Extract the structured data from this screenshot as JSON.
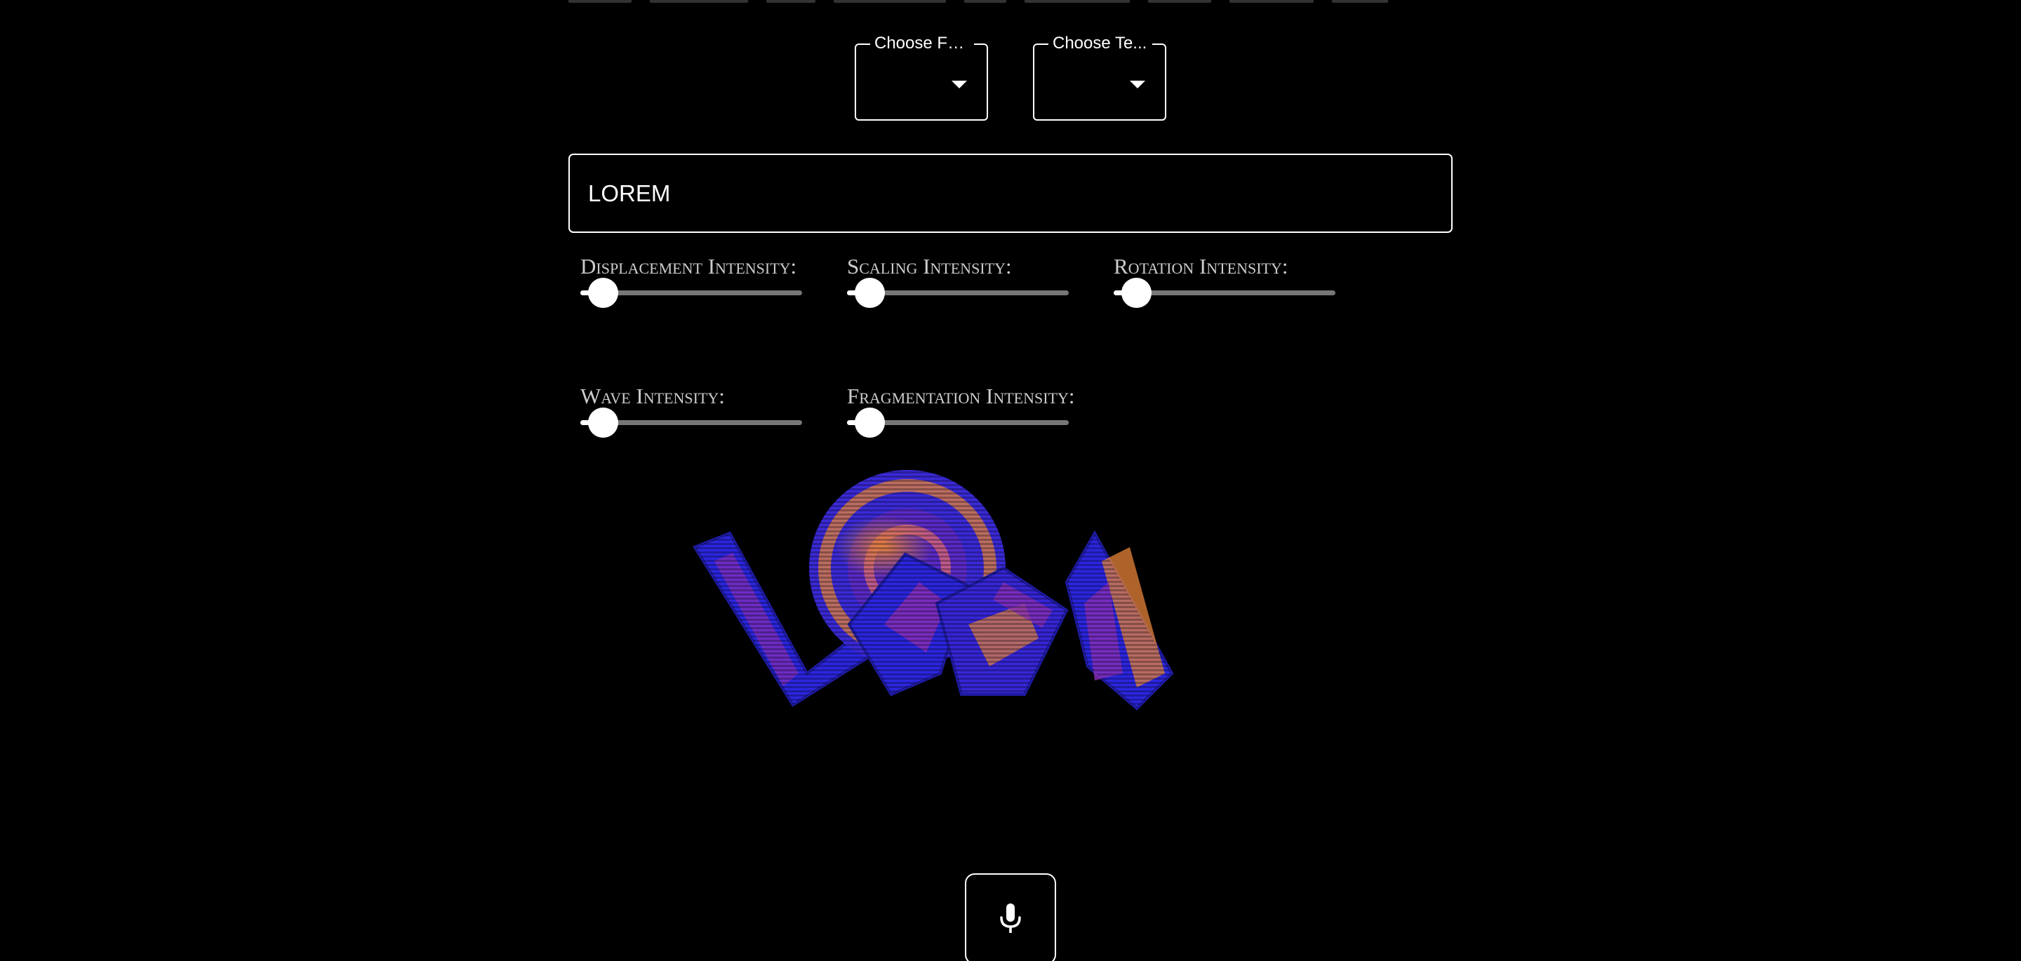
{
  "selects": [
    {
      "label": "Choose Font",
      "value": ""
    },
    {
      "label": "Choose Te...",
      "value": ""
    }
  ],
  "text_input": {
    "value": "LOREM"
  },
  "sliders": [
    {
      "label": "Displacement Intensity:",
      "value": 0.1
    },
    {
      "label": "Scaling Intensity:",
      "value": 0.1
    },
    {
      "label": "Rotation Intensity:",
      "value": 0.1
    },
    {
      "label": "Wave Intensity:",
      "value": 0.1
    },
    {
      "label": "Fragmentation Intensity:",
      "value": 0.1
    }
  ],
  "preview": {
    "text": "LOREM",
    "colors": {
      "blue": "#2b26e0",
      "orange": "#e8843a",
      "purple": "#8a2fb8",
      "deep_blue": "#1e1aa0"
    }
  },
  "mic_button": {
    "icon": "microphone-icon"
  },
  "colors": {
    "background": "#000000",
    "foreground": "#ffffff",
    "track": "#777777",
    "label": "#cccccc"
  }
}
